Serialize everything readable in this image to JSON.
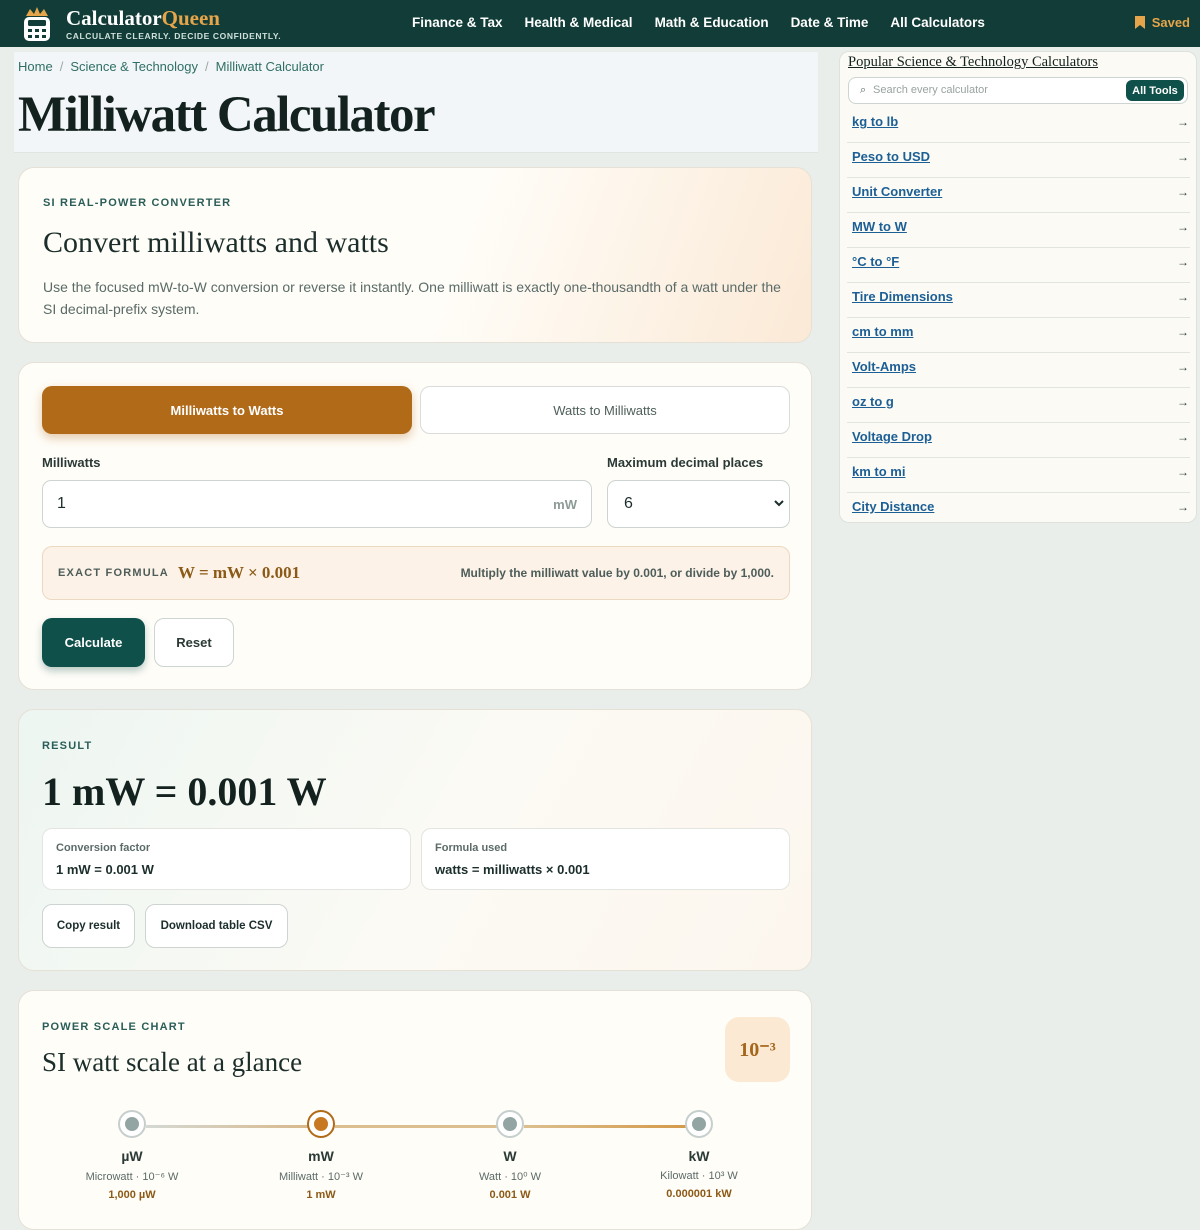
{
  "header": {
    "brand_a": "Calculator",
    "brand_b": "Queen",
    "tagline": "CALCULATE CLEARLY. DECIDE CONFIDENTLY.",
    "nav": [
      "Finance & Tax",
      "Health & Medical",
      "Math & Education",
      "Date & Time",
      "All Calculators"
    ],
    "saved_label": "Saved"
  },
  "breadcrumb": [
    "Home",
    "Science & Technology",
    "Milliwatt Calculator"
  ],
  "page_title": "Milliwatt Calculator",
  "intro": {
    "eyebrow": "SI REAL-POWER CONVERTER",
    "heading": "Convert milliwatts and watts",
    "text": "Use the focused mW-to-W conversion or reverse it instantly. One milliwatt is exactly one-thousandth of a watt under the SI decimal-prefix system."
  },
  "converter": {
    "tabs": [
      "Milliwatts to Watts",
      "Watts to Milliwatts"
    ],
    "input_label": "Milliwatts",
    "input_value": "1",
    "input_unit": "mW",
    "decimals_label": "Maximum decimal places",
    "decimals_value": "6",
    "formula_label": "EXACT FORMULA",
    "formula": "W = mW × 0.001",
    "formula_note": "Multiply the milliwatt value by 0.001, or divide by 1,000.",
    "calculate_label": "Calculate",
    "reset_label": "Reset"
  },
  "result": {
    "eyebrow": "RESULT",
    "value": "1 mW = 0.001 W",
    "factor_label": "Conversion factor",
    "factor_value": "1 mW = 0.001 W",
    "formula_label": "Formula used",
    "formula_value": "watts = milliwatts × 0.001",
    "copy_label": "Copy result",
    "csv_label": "Download table CSV"
  },
  "scale": {
    "eyebrow": "POWER SCALE CHART",
    "heading": "SI watt scale at a glance",
    "badge": "10⁻³",
    "nodes": [
      {
        "symbol": "µW",
        "name": "Microwatt · 10⁻⁶ W",
        "value": "1,000 µW",
        "active": false
      },
      {
        "symbol": "mW",
        "name": "Milliwatt · 10⁻³ W",
        "value": "1 mW",
        "active": true
      },
      {
        "symbol": "W",
        "name": "Watt · 10⁰ W",
        "value": "0.001 W",
        "active": false
      },
      {
        "symbol": "kW",
        "name": "Kilowatt · 10³ W",
        "value": "0.000001 kW",
        "active": false
      }
    ]
  },
  "sidebar": {
    "title": "Popular Science & Technology Calculators",
    "search_placeholder": "Search every calculator",
    "all_tools_label": "All Tools",
    "items": [
      "kg to lb",
      "Peso to USD",
      "Unit Converter",
      "MW to W",
      "°C to °F",
      "Tire Dimensions",
      "cm to mm",
      "Volt-Amps",
      "oz to g",
      "Voltage Drop",
      "km to mi",
      "City Distance"
    ]
  },
  "colors": {
    "header_bg": "#113c37",
    "accent_orange": "#b06a18",
    "primary_green": "#0f504a",
    "link_blue": "#1c5f95"
  }
}
